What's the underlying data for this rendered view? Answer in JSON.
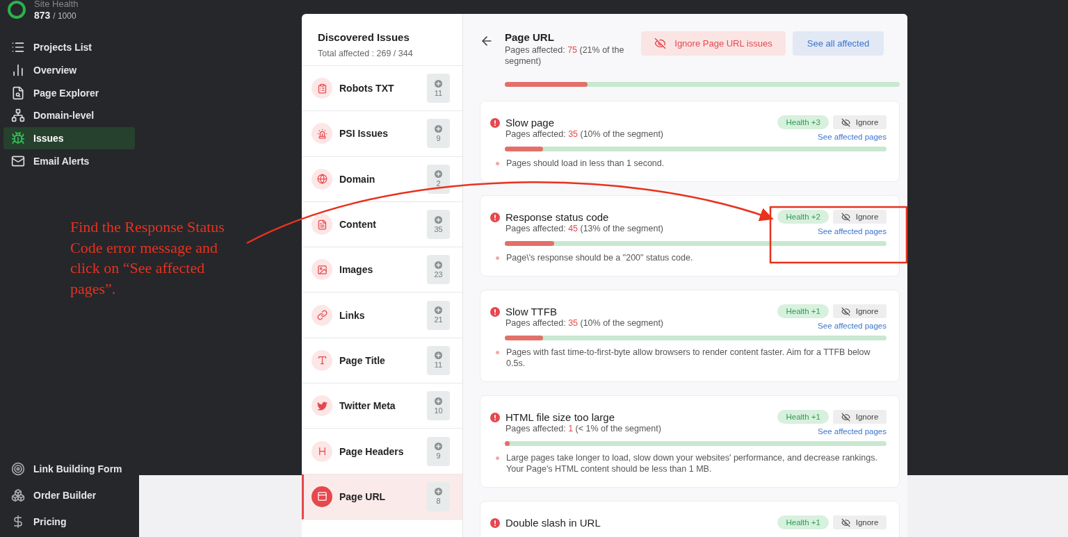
{
  "sidebar": {
    "site_health": {
      "label": "Site Health",
      "score": "873",
      "total": "/ 1000"
    },
    "nav": [
      {
        "label": "Projects List",
        "selected": false
      },
      {
        "label": "Overview",
        "selected": false
      },
      {
        "label": "Page Explorer",
        "selected": false
      },
      {
        "label": "Domain-level",
        "selected": false
      },
      {
        "label": "Issues",
        "selected": true
      },
      {
        "label": "Email Alerts",
        "selected": false
      }
    ],
    "bottom_nav": [
      {
        "label": "Link Building Form"
      },
      {
        "label": "Order Builder"
      },
      {
        "label": "Pricing"
      }
    ]
  },
  "issues_panel": {
    "title": "Discovered Issues",
    "total": "Total affected : 269 / 344",
    "categories": [
      {
        "label": "Robots TXT",
        "count": "11",
        "selected": false
      },
      {
        "label": "PSI Issues",
        "count": "9",
        "selected": false
      },
      {
        "label": "Domain",
        "count": "2",
        "selected": false
      },
      {
        "label": "Content",
        "count": "35",
        "selected": false
      },
      {
        "label": "Images",
        "count": "23",
        "selected": false
      },
      {
        "label": "Links",
        "count": "21",
        "selected": false
      },
      {
        "label": "Page Title",
        "count": "11",
        "selected": false
      },
      {
        "label": "Twitter Meta",
        "count": "10",
        "selected": false
      },
      {
        "label": "Page Headers",
        "count": "9",
        "selected": false
      },
      {
        "label": "Page URL",
        "count": "8",
        "selected": true
      }
    ]
  },
  "detail": {
    "title": "Page URL",
    "affected": "Pages affected: **75** (21% of the segment)",
    "level": 0.21,
    "ignore_button": "Ignore Page URL issues",
    "see_all_button": "See all affected",
    "issues": [
      {
        "title": "Slow page",
        "affected": "Pages affected: **35** (10% of the segment)",
        "health": "Health +3",
        "ignore": "Ignore",
        "link": "See affected pages",
        "level": 0.1,
        "note": "Pages should load in less than 1 second."
      },
      {
        "title": "Response status code",
        "affected": "Pages affected: **45** (13% of the segment)",
        "health": "Health +2",
        "ignore": "Ignore",
        "link": "See affected pages",
        "level": 0.13,
        "note": "Page\\'s response should be a \"200\" status code."
      },
      {
        "title": "Slow TTFB",
        "affected": "Pages affected: **35** (10% of the segment)",
        "health": "Health +1",
        "ignore": "Ignore",
        "link": "See affected pages",
        "level": 0.1,
        "note": "Pages with fast time-to-first-byte allow browsers to render content faster. Aim for a TTFB below 0.5s."
      },
      {
        "title": "HTML file size too large",
        "affected": "Pages affected: **1** (< 1% of the segment)",
        "health": "Health +1",
        "ignore": "Ignore",
        "link": "See affected pages",
        "level": 0.01,
        "note": "Large pages take longer to load, slow down your websites' performance, and decrease rankings. Your Page's HTML content should be less than 1 MB."
      },
      {
        "title": "Double slash in URL",
        "health": "Health +1",
        "ignore": "Ignore"
      }
    ]
  },
  "annotation": {
    "text": "Find the Response Status Code error message and click on “See affected pages”."
  }
}
